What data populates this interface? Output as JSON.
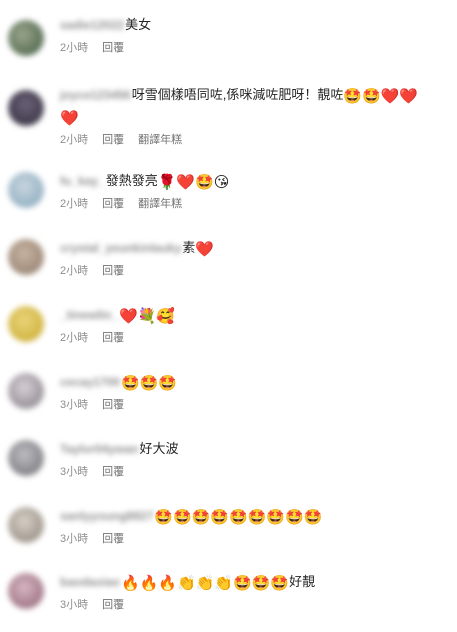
{
  "comments": [
    {
      "user": "sadie12022",
      "text": "美女",
      "emoji": "",
      "time": "2小時",
      "reply": "回覆",
      "translate": "",
      "avatar_color": "#3f5a42",
      "avatar_color2": "#9aa58a"
    },
    {
      "user": "joyce123456",
      "text": "呀雪個樣唔同咗,係咪減咗肥呀！靚咗",
      "emoji": "🤩🤩❤️❤️",
      "emoji2": "❤️",
      "time": "2小時",
      "reply": "回覆",
      "translate": "翻譯年糕",
      "avatar_color": "#2e2a38",
      "avatar_color2": "#6b6278"
    },
    {
      "user": "fu_kay_",
      "text": "發熱發亮",
      "emoji": "🌹❤️🤩😘",
      "time": "2小時",
      "reply": "回覆",
      "translate": "翻譯年糕",
      "avatar_color": "#7fa3b8",
      "avatar_color2": "#c9d6df"
    },
    {
      "user": "crystal_yeunkinlauky",
      "text": "素",
      "emoji": "❤️",
      "time": "2小時",
      "reply": "回覆",
      "translate": "",
      "avatar_color": "#8b7766",
      "avatar_color2": "#c8b4a2"
    },
    {
      "user": "_tinewlin_",
      "text": "",
      "emoji": "❤️💐🥰",
      "time": "2小時",
      "reply": "回覆",
      "translate": "",
      "avatar_color": "#c9a62a",
      "avatar_color2": "#e8d57a"
    },
    {
      "user": "cecay1700",
      "text": "",
      "emoji": "🤩🤩🤩",
      "time": "3小時",
      "reply": "回覆",
      "translate": "",
      "avatar_color": "#7d7580",
      "avatar_color2": "#d8d2d6"
    },
    {
      "user": "Taylor04ywan",
      "text": "好大波",
      "emoji": "",
      "time": "3小時",
      "reply": "回覆",
      "translate": "",
      "avatar_color": "#6c6c70",
      "avatar_color2": "#bdbdc2"
    },
    {
      "user": "sanlyyoung8827",
      "text": "",
      "emoji": "🤩🤩🤩🤩🤩🤩🤩🤩🤩",
      "time": "3小時",
      "reply": "回覆",
      "translate": "",
      "avatar_color": "#8a8074",
      "avatar_color2": "#d6d0c8"
    },
    {
      "user": "baodaoiao",
      "text": "好靚",
      "emoji": "🔥🔥🔥👏👏👏🤩🤩🤩",
      "time": "3小時",
      "reply": "回覆",
      "translate": "",
      "avatar_color": "#8c5d6f",
      "avatar_color2": "#d7b7c3"
    }
  ]
}
